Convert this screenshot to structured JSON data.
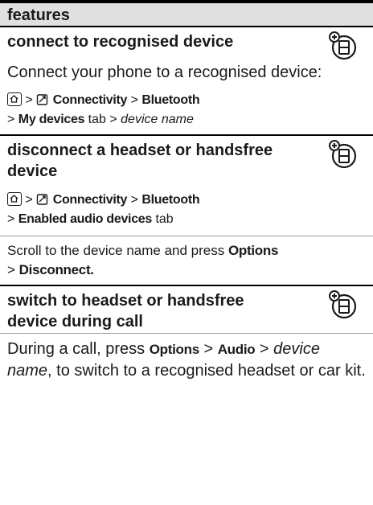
{
  "header": {
    "title": "features"
  },
  "sections": [
    {
      "title": "connect to recognised device",
      "body": "Connect your phone to a recognised device:",
      "path1": {
        "sep1": ">",
        "menu": "Connectivity",
        "sep2": ">",
        "item": "Bluetooth"
      },
      "path2": {
        "sep1": ">",
        "tab": "My devices",
        "tab_word": "tab",
        "sep2": ">",
        "target": "device name"
      }
    },
    {
      "title": "disconnect a headset or handsfree device",
      "path1": {
        "sep1": ">",
        "menu": "Connectivity",
        "sep2": ">",
        "item": "Bluetooth"
      },
      "path2": {
        "sep1": ">",
        "tab": "Enabled audio devices",
        "tab_word": "tab"
      },
      "body_prefix": "Scroll to the device name and press",
      "options": "Options",
      "body_line2_sep": ">",
      "disconnect": "Disconnect."
    },
    {
      "title": "switch to headset or handsfree device during call",
      "body_prefix": "During a call, press",
      "options": "Options",
      "sep1": ">",
      "audio": "Audio",
      "sep2": ">",
      "target": "device name",
      "body_suffix": ", to switch to a recognised headset or car kit."
    }
  ],
  "icons": {
    "feature_icon": "network-feature-icon",
    "home_key": "home-key-icon",
    "connectivity": "connectivity-menu-icon"
  }
}
